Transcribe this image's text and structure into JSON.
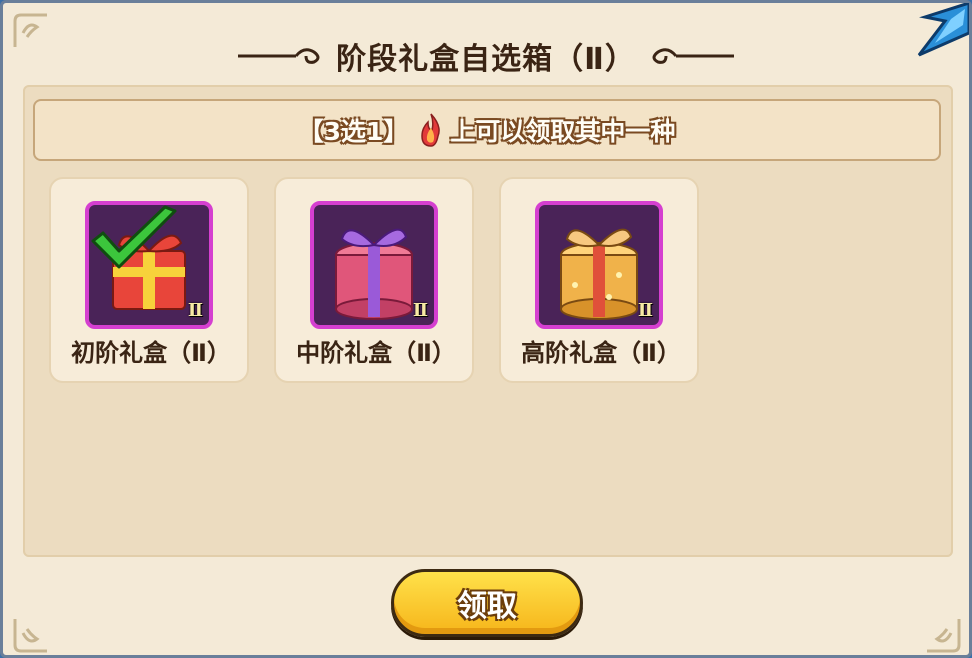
{
  "dialog": {
    "title": "阶段礼盒自选箱（Ⅱ）"
  },
  "banner": {
    "prefix": "【3选1】",
    "text": "上可以领取其中一种",
    "icon": "flame-icon"
  },
  "items": [
    {
      "label": "初阶礼盒（Ⅱ）",
      "tier": "Ⅱ",
      "selected": true,
      "color": "#e8453a"
    },
    {
      "label": "中阶礼盒（Ⅱ）",
      "tier": "Ⅱ",
      "selected": false,
      "color": "#e0567a"
    },
    {
      "label": "高阶礼盒（Ⅱ）",
      "tier": "Ⅱ",
      "selected": false,
      "color": "#f0b24a"
    }
  ],
  "claim_button": {
    "label": "领取"
  },
  "colors": {
    "panel": "#ecdcc0",
    "frame_border": "#d53fd0",
    "button": "#ffd233"
  }
}
